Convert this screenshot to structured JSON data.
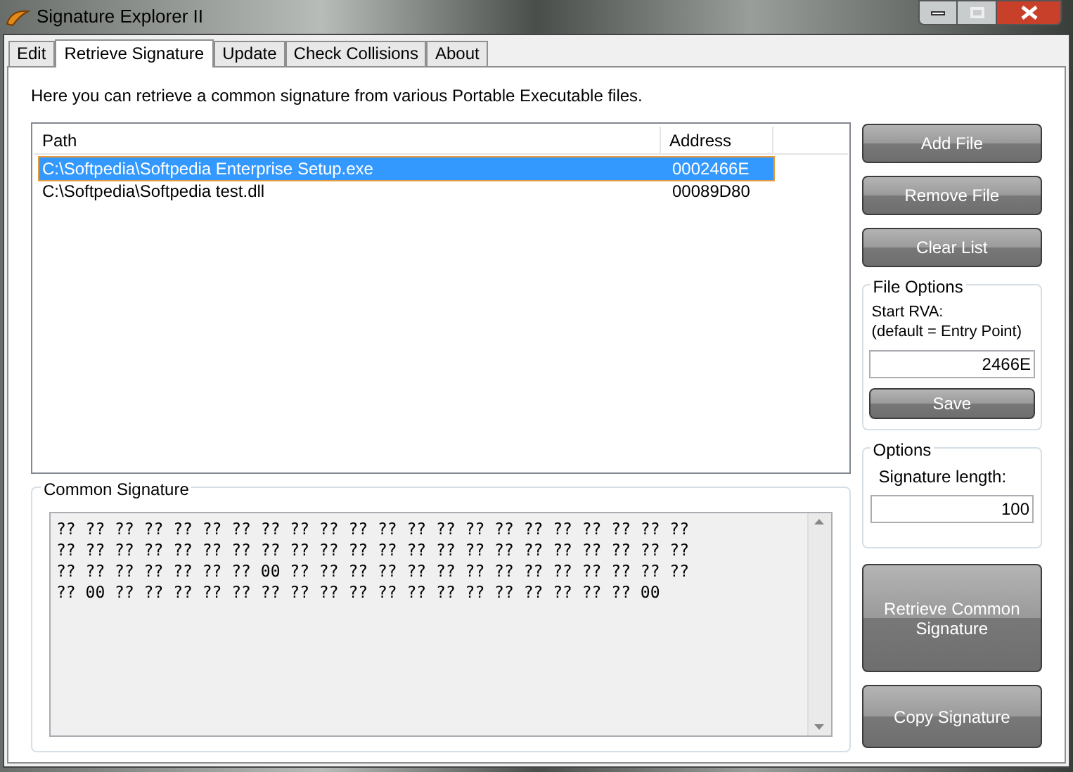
{
  "window": {
    "title": "Signature Explorer II"
  },
  "tabs": [
    {
      "label": "Edit",
      "selected": false
    },
    {
      "label": "Retrieve Signature",
      "selected": true
    },
    {
      "label": "Update",
      "selected": false
    },
    {
      "label": "Check Collisions",
      "selected": false
    },
    {
      "label": "About",
      "selected": false
    }
  ],
  "intro": "Here you can retrieve a common signature from various Portable Executable files.",
  "file_list": {
    "columns": [
      "Path",
      "Address"
    ],
    "rows": [
      {
        "path": "C:\\Softpedia\\Softpedia Enterprise Setup.exe",
        "address": "0002466E",
        "selected": true
      },
      {
        "path": "C:\\Softpedia\\Softpedia test.dll",
        "address": "00089D80",
        "selected": false
      }
    ]
  },
  "list_buttons": [
    "Add File",
    "Remove File",
    "Clear List"
  ],
  "file_options": {
    "title": "File Options",
    "label": "Start RVA:\n(default = Entry Point)",
    "value": "2466E",
    "button": "Save"
  },
  "options": {
    "title": "Options",
    "label": "Signature length:",
    "value": "100"
  },
  "common_signature": {
    "title": "Common Signature",
    "lines": [
      "?? ?? ?? ?? ?? ?? ?? ?? ?? ?? ?? ?? ?? ?? ?? ?? ?? ?? ?? ?? ?? ??",
      "?? ?? ?? ?? ?? ?? ?? ?? ?? ?? ?? ?? ?? ?? ?? ?? ?? ?? ?? ?? ?? ??",
      "?? ?? ?? ?? ?? ?? ?? 00 ?? ?? ?? ?? ?? ?? ?? ?? ?? ?? ?? ?? ?? ??",
      "?? 00 ?? ?? ?? ?? ?? ?? ?? ?? ?? ?? ?? ?? ?? ?? ?? ?? ?? ?? 00"
    ]
  },
  "action_buttons": [
    "Retrieve Common Signature",
    "Copy Signature"
  ]
}
